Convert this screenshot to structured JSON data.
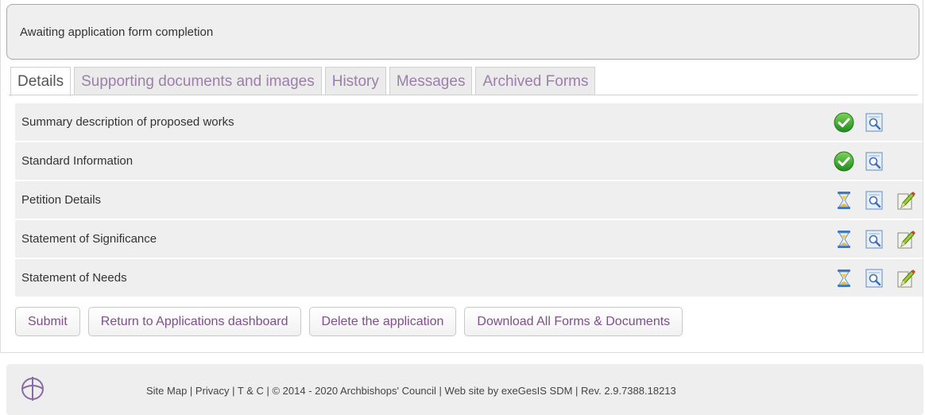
{
  "status": {
    "text": "Awaiting application form completion"
  },
  "tabs": [
    {
      "label": "Details",
      "active": true
    },
    {
      "label": "Supporting documents and images",
      "active": false
    },
    {
      "label": "History",
      "active": false
    },
    {
      "label": "Messages",
      "active": false
    },
    {
      "label": "Archived Forms",
      "active": false
    }
  ],
  "forms": [
    {
      "label": "Summary description of proposed works",
      "state": "complete",
      "icons": [
        "check-icon",
        "view-icon"
      ]
    },
    {
      "label": "Standard Information",
      "state": "complete",
      "icons": [
        "check-icon",
        "view-icon"
      ]
    },
    {
      "label": "Petition Details",
      "state": "pending",
      "icons": [
        "hourglass-icon",
        "view-icon",
        "edit-icon"
      ]
    },
    {
      "label": "Statement of Significance",
      "state": "pending",
      "icons": [
        "hourglass-icon",
        "view-icon",
        "edit-icon"
      ]
    },
    {
      "label": "Statement of Needs",
      "state": "pending",
      "icons": [
        "hourglass-icon",
        "view-icon",
        "edit-icon"
      ]
    }
  ],
  "buttons": {
    "submit": "Submit",
    "return": "Return to Applications dashboard",
    "delete": "Delete the application",
    "download": "Download All Forms & Documents"
  },
  "footer": {
    "text": "Site Map | Privacy | T & C | © 2014 - 2020 Archbishops' Council | Web site by exeGesIS SDM | Rev. 2.9.7388.18213",
    "logo_icon": "church-of-england-logo-icon"
  },
  "colors": {
    "accent": "#7f4f8a",
    "tab_text": "#9b7fa8",
    "complete": "#2e9e2e",
    "row_bg": "#efefef"
  }
}
